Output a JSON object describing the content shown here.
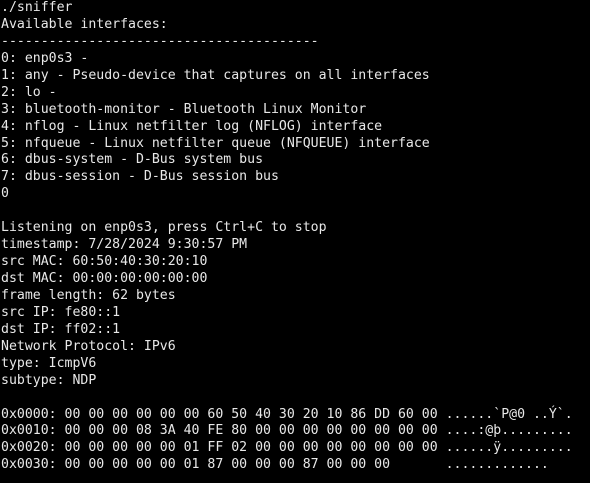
{
  "terminal": {
    "background": "#000000",
    "foreground": "#e8e8e8",
    "top_cut_text": "",
    "lines": [
      "./sniffer",
      "Available interfaces:",
      "----------------------------------------",
      "0: enp0s3 -",
      "1: any - Pseudo-device that captures on all interfaces",
      "2: lo -",
      "3: bluetooth-monitor - Bluetooth Linux Monitor",
      "4: nflog - Linux netfilter log (NFLOG) interface",
      "5: nfqueue - Linux netfilter queue (NFQUEUE) interface",
      "6: dbus-system - D-Bus system bus",
      "7: dbus-session - D-Bus session bus",
      "0",
      "",
      "Listening on enp0s3, press Ctrl+C to stop",
      "timestamp: 7/28/2024 9:30:57 PM",
      "src MAC: 60:50:40:30:20:10",
      "dst MAC: 00:00:00:00:00:00",
      "frame length: 62 bytes",
      "src IP: fe80::1",
      "dst IP: ff02::1",
      "Network Protocol: IPv6",
      "type: IcmpV6",
      "subtype: NDP",
      "",
      "0x0000: 00 00 00 00 00 00 60 50 40 30 20 10 86 DD 60 00 ......`P@0 ..Ý`.",
      "0x0010: 00 00 00 08 3A 40 FE 80 00 00 00 00 00 00 00 00 ....:@þ.........",
      "0x0020: 00 00 00 00 00 01 FF 02 00 00 00 00 00 00 00 00 ......ÿ.........",
      "0x0030: 00 00 00 00 00 01 87 00 00 00 87 00 00 00       ............."
    ]
  }
}
